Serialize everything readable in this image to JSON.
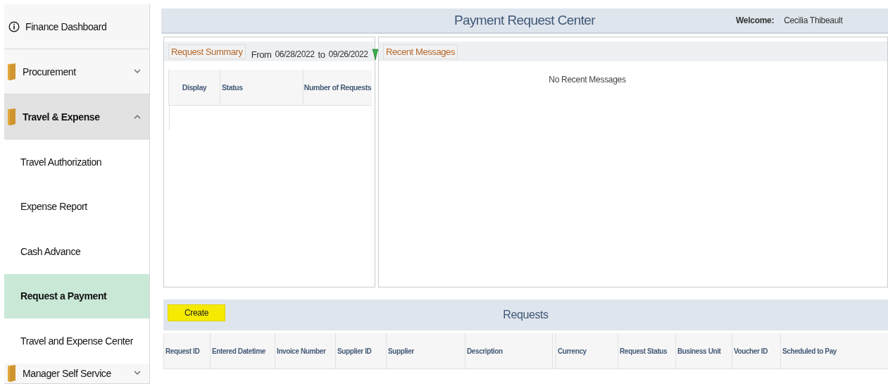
{
  "sidebar": {
    "items": [
      {
        "kind": "link",
        "label": "Finance Dashboard"
      },
      {
        "kind": "folder",
        "label": "Procurement",
        "expanded": false
      },
      {
        "kind": "folder",
        "label": "Travel & Expense",
        "expanded": true,
        "children": [
          {
            "label": "Travel Authorization",
            "selected": false
          },
          {
            "label": "Expense Report",
            "selected": false
          },
          {
            "label": "Cash Advance",
            "selected": false
          },
          {
            "label": "Request a Payment",
            "selected": true
          },
          {
            "label": "Travel and Expense Center",
            "selected": false
          }
        ]
      },
      {
        "kind": "folder",
        "label": "Manager Self Service",
        "expanded": false
      }
    ]
  },
  "header": {
    "title": "Payment Request Center",
    "welcome_label": "Welcome:",
    "user": "Cecilia Thibeault"
  },
  "request_summary": {
    "title": "Request Summary",
    "from_label": "From",
    "from_date": "06/28/2022",
    "to_label": "to",
    "to_date": "09/26/2022",
    "columns": [
      "Display",
      "Status",
      "Number of Requests"
    ]
  },
  "recent_messages": {
    "title": "Recent Messages",
    "empty_text": "No Recent Messages"
  },
  "requests": {
    "create_button": "Create",
    "title": "Requests",
    "columns": [
      "Request ID",
      "Entered Datetime",
      "Invoice Number",
      "Supplier ID",
      "Supplier",
      "Description",
      "Currency",
      "Request Status",
      "Business Unit",
      "Voucher ID",
      "Scheduled to Pay"
    ]
  }
}
